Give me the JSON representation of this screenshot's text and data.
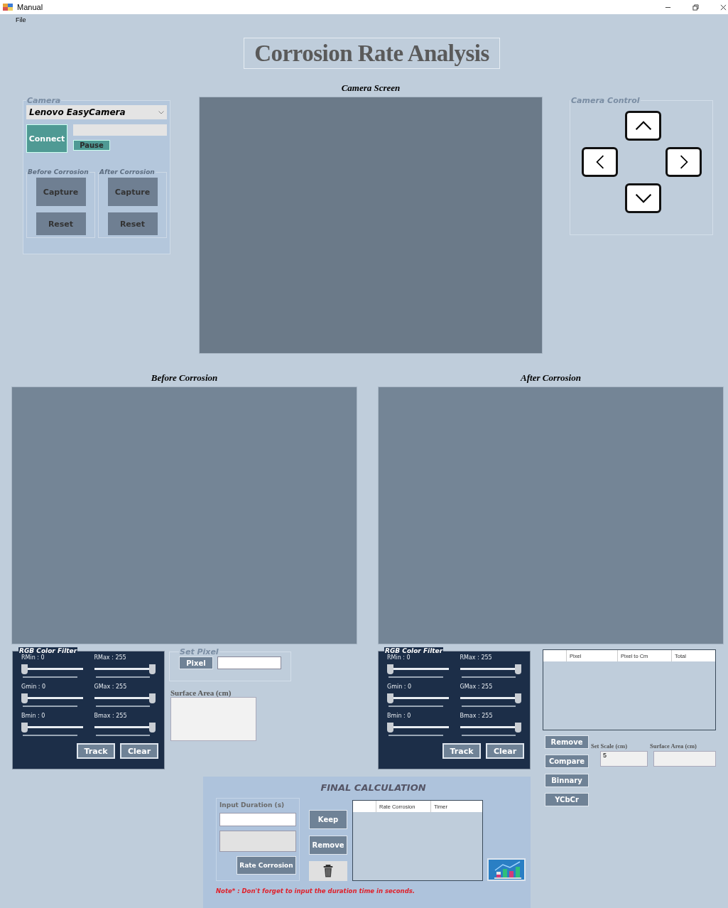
{
  "window": {
    "title": "Manual"
  },
  "menu": [
    "File"
  ],
  "header": {
    "title": "Corrosion Rate Analysis"
  },
  "camera": {
    "legend": "Camera",
    "device": "Lenovo EasyCamera",
    "connect": "Connect",
    "pause": "Pause",
    "groups": [
      {
        "legend": "Before Corrosion",
        "buttons": [
          "Capture",
          "Reset"
        ]
      },
      {
        "legend": "After Corrosion",
        "buttons": [
          "Capture",
          "Reset"
        ]
      }
    ]
  },
  "camera_screen": {
    "label": "Camera Screen"
  },
  "camera_control": {
    "legend": "Camera Control"
  },
  "views": [
    {
      "label": "Before Corrosion"
    },
    {
      "label": "After Corrosion"
    }
  ],
  "filters": [
    {
      "legend": "RGB Color Filter",
      "sliders": [
        {
          "label": "RMin : 0",
          "level": 0
        },
        {
          "label": "RMax : 255",
          "level": 1
        },
        {
          "label": "Gmin : 0",
          "level": 0
        },
        {
          "label": "GMax : 255",
          "level": 1
        },
        {
          "label": "Bmin : 0",
          "level": 0
        },
        {
          "label": "Bmax : 255",
          "level": 1
        }
      ],
      "buttons": [
        "Track",
        "Clear"
      ]
    },
    {
      "legend": "RGB Color Filter",
      "sliders": [
        {
          "label": "RMin : 0",
          "level": 0
        },
        {
          "label": "RMax : 255",
          "level": 1
        },
        {
          "label": "Gmin : 0",
          "level": 0
        },
        {
          "label": "GMax : 255",
          "level": 1
        },
        {
          "label": "Bmin : 0",
          "level": 0
        },
        {
          "label": "Bmax : 255",
          "level": 1
        }
      ],
      "buttons": [
        "Track",
        "Clear"
      ]
    }
  ],
  "set_pixel": {
    "legend": "Set Pixel",
    "button": "Pixel"
  },
  "surface_area_left": {
    "label": "Surface Area (cm)"
  },
  "measure_table": {
    "columns": [
      "Pixel",
      "Pixel to Cm",
      "Total"
    ]
  },
  "tool_buttons": [
    "Remove",
    "Compare",
    "Binnary",
    "YCbCr"
  ],
  "scale": {
    "label": "Set Scale (cm)",
    "value": "5"
  },
  "surface_area_right": {
    "label": "Surface Area (cm)"
  },
  "final": {
    "title": "FINAL CALCULATION",
    "duration_label": "Input Duration (s)",
    "rate_button": "Rate Corrosion",
    "keep": "Keep",
    "remove": "Remove",
    "columns": [
      "Rate Corrosion",
      "Timer"
    ],
    "note": "Note* : Don't forget to input the duration time in seconds."
  }
}
